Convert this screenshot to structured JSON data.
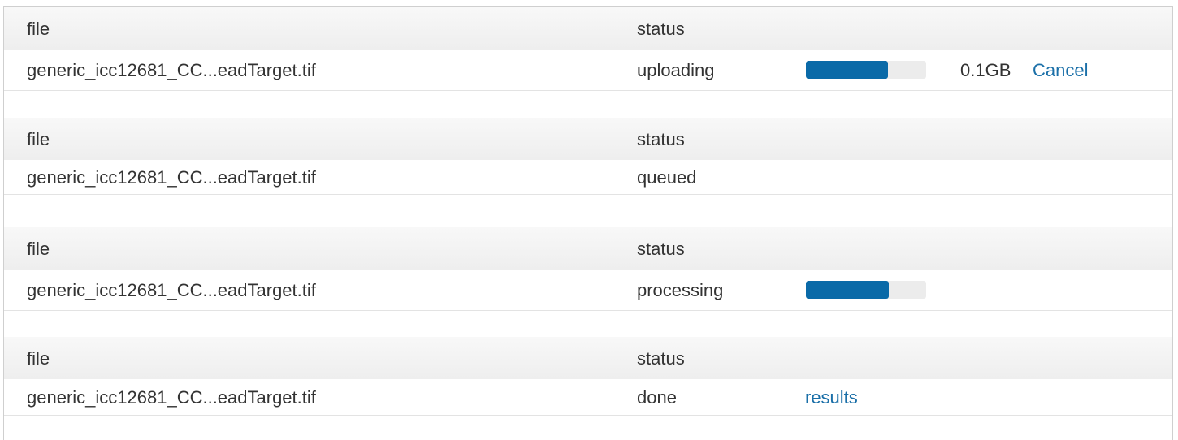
{
  "colors": {
    "progress_fill": "#0a6aa8",
    "progress_track": "#ececec",
    "link": "#1a6fa8",
    "header_bg": "#f1f1f1"
  },
  "uploads": [
    {
      "header": {
        "file": "file",
        "status": "status"
      },
      "file": "generic_icc12681_CC...eadTarget.tif",
      "status": "uploading",
      "progress": 0.68,
      "size": "0.1GB",
      "action": "Cancel"
    },
    {
      "header": {
        "file": "file",
        "status": "status"
      },
      "file": "generic_icc12681_CC...eadTarget.tif",
      "status": "queued"
    },
    {
      "header": {
        "file": "file",
        "status": "status"
      },
      "file": "generic_icc12681_CC...eadTarget.tif",
      "status": "processing",
      "progress": 0.69
    },
    {
      "header": {
        "file": "file",
        "status": "status"
      },
      "file": "generic_icc12681_CC...eadTarget.tif",
      "status": "done",
      "action": "results"
    }
  ]
}
